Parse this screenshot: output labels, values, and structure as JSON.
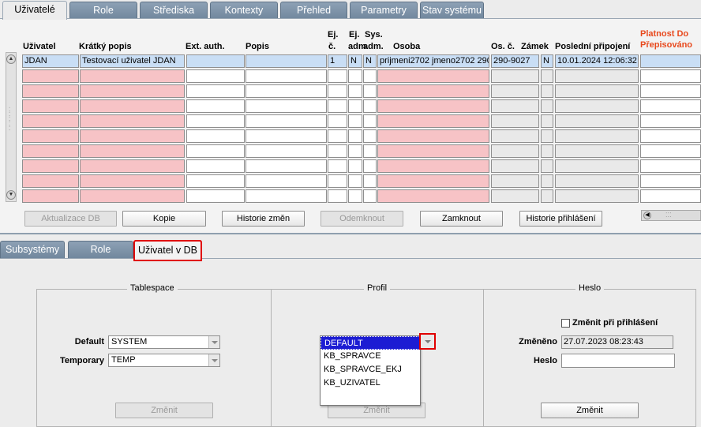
{
  "top_tabs": [
    "Uživatelé",
    "Role",
    "Střediska",
    "Kontexty",
    "Přehled",
    "Parametry",
    "Stav systému"
  ],
  "table": {
    "headers": {
      "uzivatel": "Uživatel",
      "kratky_popis": "Krátký popis",
      "ext_auth": "Ext. auth.",
      "popis": "Popis",
      "ej_c_1": "Ej.",
      "ej_c_2": "č.",
      "ej_adm_1": "Ej.",
      "ej_adm_2": "adm.",
      "sys_adm_1": "Sys.",
      "sys_adm_2": "adm.",
      "osoba": "Osoba",
      "os_c": "Os. č.",
      "zamek": "Zámek",
      "posledni_pripojeni": "Poslední připojení",
      "platnost_1": "Platnost Do",
      "platnost_2": "Přepisováno"
    },
    "row1": {
      "uzivatel": "JDAN",
      "kratky_popis": "Testovací uživatel JDAN",
      "ext_auth": "",
      "popis": "",
      "ej_c": "1",
      "ej_adm": "N",
      "sys_adm": "N",
      "osoba": "prijmeni2702 jmeno2702 290-",
      "os_c": "290-9027",
      "zamek": "N",
      "posledni_pripojeni": "10.01.2024 12:06:32"
    },
    "empty_rows": 9
  },
  "buttons": {
    "aktualizace": "Aktualizace DB",
    "kopie": "Kopie",
    "historie_zmen": "Historie změn",
    "odemknout": "Odemknout",
    "zamknout": "Zamknout",
    "historie_prihlaseni": "Historie přihlášení"
  },
  "lower_tabs": [
    "Subsystémy",
    "Role",
    "Uživatel v DB"
  ],
  "tablespace": {
    "title": "Tablespace",
    "default_label": "Default",
    "default_value": "SYSTEM",
    "temporary_label": "Temporary",
    "temporary_value": "TEMP",
    "button": "Změnit"
  },
  "profil": {
    "title": "Profil",
    "options": [
      "DEFAULT",
      "KB_SPRAVCE",
      "KB_SPRAVCE_EKJ",
      "KB_UZIVATEL"
    ],
    "selected": "DEFAULT",
    "button": "Změnit"
  },
  "heslo": {
    "title": "Heslo",
    "change_on_login_label": "Změnit při přihlášení",
    "change_on_login_checked": false,
    "zmeneno_label": "Změněno",
    "zmeneno_value": "27.07.2023 08:23:43",
    "heslo_label": "Heslo",
    "heslo_value": "",
    "button": "Změnit"
  }
}
